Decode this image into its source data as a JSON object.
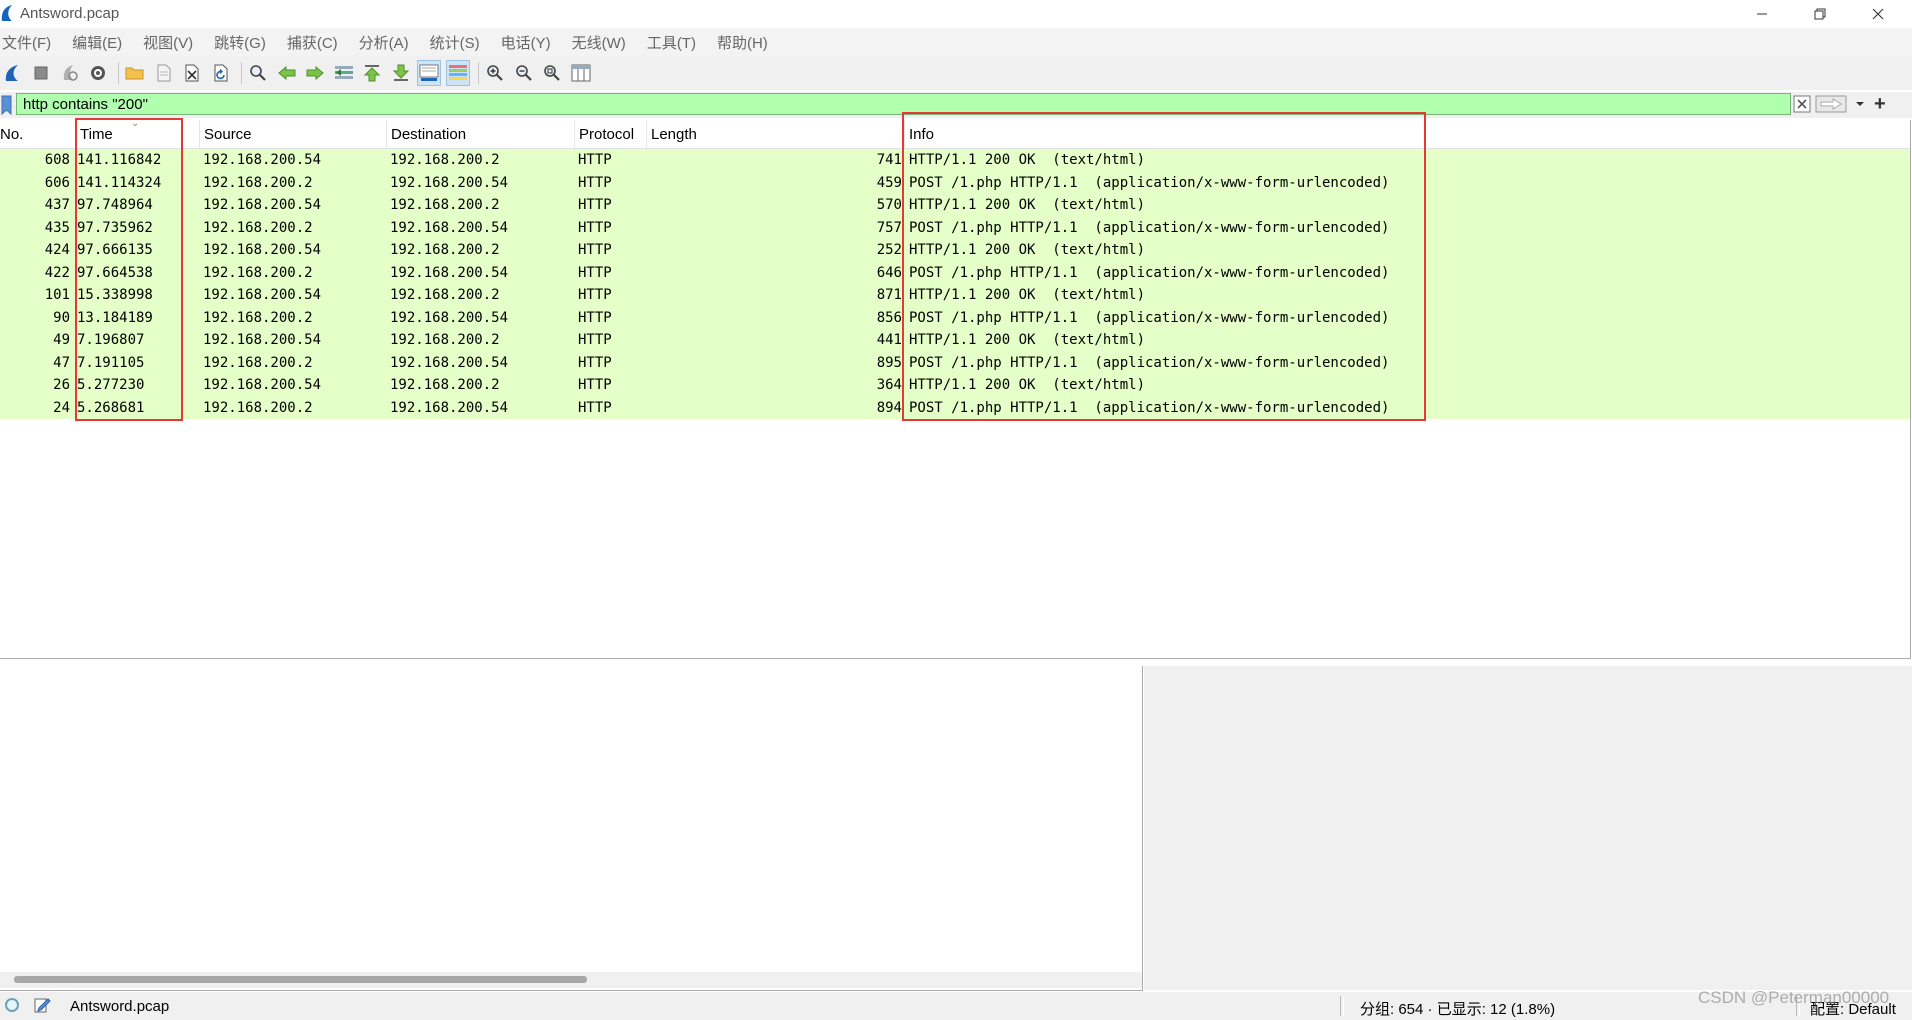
{
  "window": {
    "title": "Antsword.pcap",
    "controls": [
      "minimize-icon",
      "restore-icon",
      "close-icon"
    ]
  },
  "menu": [
    "文件(F)",
    "编辑(E)",
    "视图(V)",
    "跳转(G)",
    "捕获(C)",
    "分析(A)",
    "统计(S)",
    "电话(Y)",
    "无线(W)",
    "工具(T)",
    "帮助(H)"
  ],
  "toolbar": {
    "icons": [
      "shark-fin-start-icon",
      "stop-icon",
      "restart-icon",
      "capture-options-icon",
      "open-file-icon",
      "save-file-icon",
      "close-file-icon",
      "reload-icon",
      "find-packet-icon",
      "go-back-icon",
      "go-forward-icon",
      "go-to-packet-icon",
      "first-packet-icon",
      "last-packet-icon",
      "autoscroll-icon",
      "colorize-icon",
      "zoom-in-icon",
      "zoom-out-icon",
      "zoom-normal-icon",
      "resize-columns-icon"
    ]
  },
  "filter": {
    "value": "http contains \"200\""
  },
  "packet_list": {
    "columns": {
      "no": "No.",
      "time": "Time",
      "source": "Source",
      "destination": "Destination",
      "protocol": "Protocol",
      "length": "Length",
      "info": "Info"
    },
    "rows": [
      {
        "no": "608",
        "time": "141.116842",
        "source": "192.168.200.54",
        "destination": "192.168.200.2",
        "protocol": "HTTP",
        "length": "741",
        "info": "HTTP/1.1 200 OK  (text/html)"
      },
      {
        "no": "606",
        "time": "141.114324",
        "source": "192.168.200.2",
        "destination": "192.168.200.54",
        "protocol": "HTTP",
        "length": "459",
        "info": "POST /1.php HTTP/1.1  (application/x-www-form-urlencoded)"
      },
      {
        "no": "437",
        "time": "97.748964",
        "source": "192.168.200.54",
        "destination": "192.168.200.2",
        "protocol": "HTTP",
        "length": "570",
        "info": "HTTP/1.1 200 OK  (text/html)"
      },
      {
        "no": "435",
        "time": "97.735962",
        "source": "192.168.200.2",
        "destination": "192.168.200.54",
        "protocol": "HTTP",
        "length": "757",
        "info": "POST /1.php HTTP/1.1  (application/x-www-form-urlencoded)"
      },
      {
        "no": "424",
        "time": "97.666135",
        "source": "192.168.200.54",
        "destination": "192.168.200.2",
        "protocol": "HTTP",
        "length": "252",
        "info": "HTTP/1.1 200 OK  (text/html)"
      },
      {
        "no": "422",
        "time": "97.664538",
        "source": "192.168.200.2",
        "destination": "192.168.200.54",
        "protocol": "HTTP",
        "length": "646",
        "info": "POST /1.php HTTP/1.1  (application/x-www-form-urlencoded)"
      },
      {
        "no": "101",
        "time": "15.338998",
        "source": "192.168.200.54",
        "destination": "192.168.200.2",
        "protocol": "HTTP",
        "length": "871",
        "info": "HTTP/1.1 200 OK  (text/html)"
      },
      {
        "no": "90",
        "time": "13.184189",
        "source": "192.168.200.2",
        "destination": "192.168.200.54",
        "protocol": "HTTP",
        "length": "856",
        "info": "POST /1.php HTTP/1.1  (application/x-www-form-urlencoded)"
      },
      {
        "no": "49",
        "time": "7.196807",
        "source": "192.168.200.54",
        "destination": "192.168.200.2",
        "protocol": "HTTP",
        "length": "441",
        "info": "HTTP/1.1 200 OK  (text/html)"
      },
      {
        "no": "47",
        "time": "7.191105",
        "source": "192.168.200.2",
        "destination": "192.168.200.54",
        "protocol": "HTTP",
        "length": "895",
        "info": "POST /1.php HTTP/1.1  (application/x-www-form-urlencoded)"
      },
      {
        "no": "26",
        "time": "5.277230",
        "source": "192.168.200.54",
        "destination": "192.168.200.2",
        "protocol": "HTTP",
        "length": "364",
        "info": "HTTP/1.1 200 OK  (text/html)"
      },
      {
        "no": "24",
        "time": "5.268681",
        "source": "192.168.200.2",
        "destination": "192.168.200.54",
        "protocol": "HTTP",
        "length": "894",
        "info": "POST /1.php HTTP/1.1  (application/x-www-form-urlencoded)"
      }
    ],
    "row_color": "#e4ffc7"
  },
  "annotations": {
    "highlight_color": "#e53935"
  },
  "status": {
    "file": "Antsword.pcap",
    "packets": "分组: 654 · 已显示: 12 (1.8%)",
    "profile": "配置: Default"
  },
  "watermark": "CSDN @Peterman00000"
}
